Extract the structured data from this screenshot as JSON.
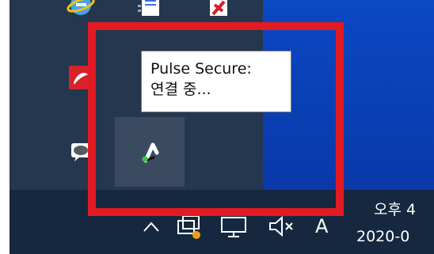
{
  "tooltip": {
    "title": "Pulse Secure:",
    "status": "연결 중..."
  },
  "taskbar": {
    "input_indicator": "A",
    "clock_time": "오후 4",
    "clock_date": "2020-0"
  },
  "colors": {
    "highlight": "#e21b22",
    "flyout_bg": "#24374f",
    "taskbar_bg": "#15283f",
    "desktop_bg": "#0a3fb0",
    "pulse_green": "#2ecc40",
    "notify_dot": "#f39c12"
  },
  "icons": {
    "tray": [
      "internet-explorer-icon",
      "document-icon",
      "pdf-icon",
      "adobe-acrobat-icon",
      "skype-icon",
      "chat-bubble-icon",
      "pulse-secure-icon"
    ],
    "system": [
      "chevron-up-icon",
      "network-icon",
      "display-icon",
      "speaker-muted-icon"
    ]
  }
}
